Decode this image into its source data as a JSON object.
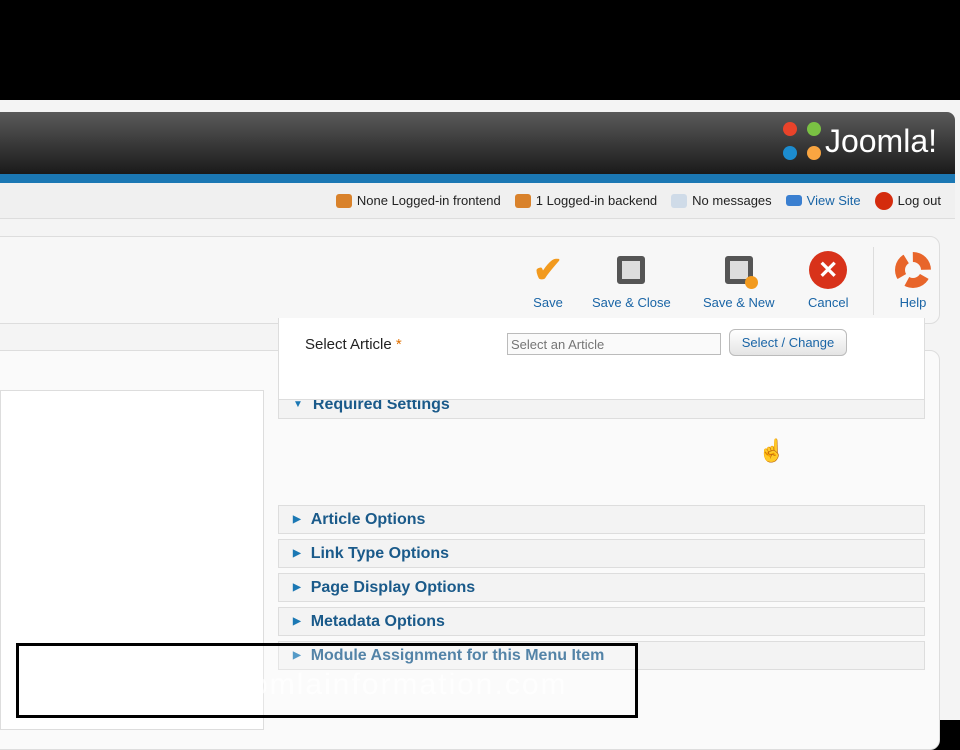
{
  "header": {
    "logo_text": "Joomla!"
  },
  "status": {
    "frontend": "None Logged-in frontend",
    "backend": "1 Logged-in backend",
    "messages": "No messages",
    "view_site": "View Site",
    "logout": "Log out"
  },
  "toolbar": {
    "save": "Save",
    "save_close": "Save & Close",
    "save_new": "Save & New",
    "cancel": "Cancel",
    "help": "Help"
  },
  "required": {
    "title": "Required Settings",
    "select_article_label": "Select Article",
    "required_mark": "*",
    "article_placeholder": "Select an Article",
    "select_change": "Select / Change"
  },
  "panels": [
    "Article Options",
    "Link Type Options",
    "Page Display Options",
    "Metadata Options",
    "Module Assignment for this Menu Item"
  ],
  "watermark": "http://www.joomlainformation.com"
}
